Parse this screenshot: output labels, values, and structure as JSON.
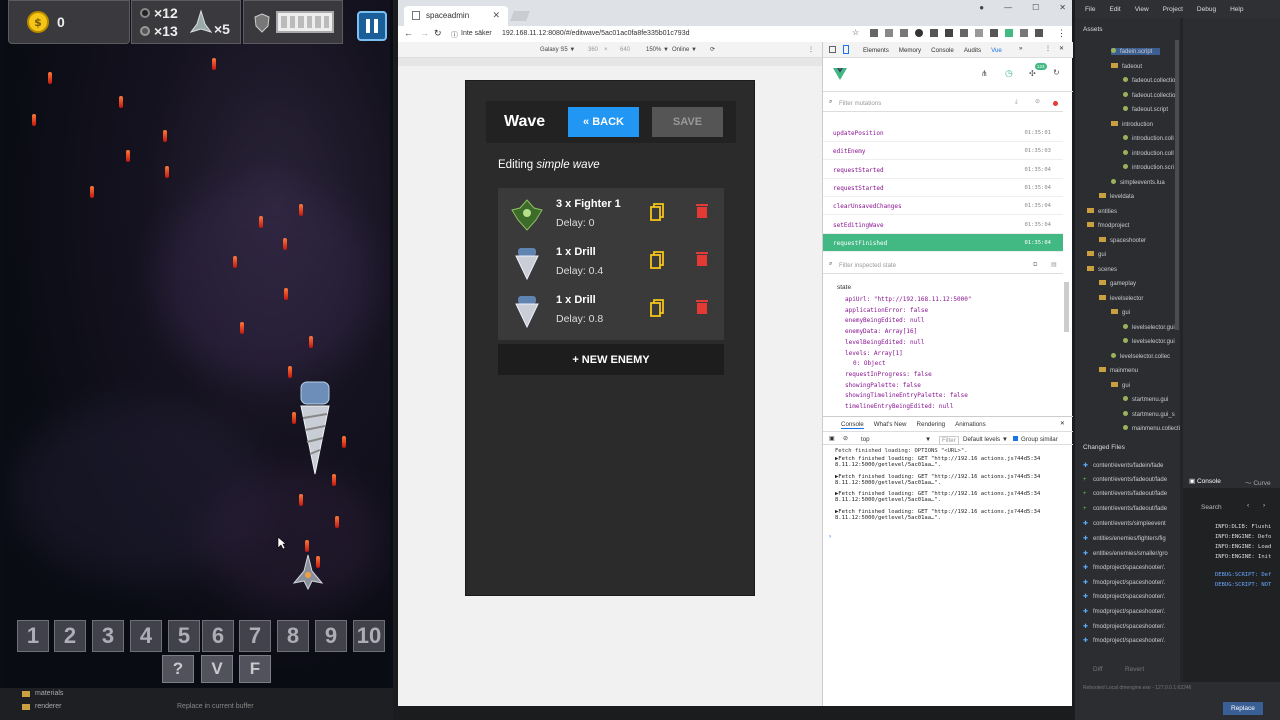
{
  "game": {
    "coins": "0",
    "mines": "×12",
    "bombs": "×13",
    "lives": "×5",
    "numkeys": [
      "1",
      "2",
      "3",
      "4",
      "5",
      "6",
      "7",
      "8",
      "9",
      "10"
    ],
    "letterkeys": [
      "?",
      "V",
      "F"
    ]
  },
  "editor_footer": {
    "items": [
      "materials",
      "renderer"
    ],
    "replace": "Replace in current buffer"
  },
  "browser": {
    "tab_title": "spaceadmin",
    "warn": "Inte säker",
    "url": "192.168.11.12:8080/#/editwave/5ac01ac0fa8fe335b01c793d",
    "device": "Galaxy S5 ▼",
    "w": "360",
    "h": "640",
    "zoom": "150% ▼",
    "net": "Online ▼"
  },
  "app": {
    "title": "Wave",
    "back": "« BACK",
    "save": "SAVE",
    "editing": "Editing",
    "wave_name": "simple wave",
    "new_enemy": "+ NEW ENEMY",
    "enemies": [
      {
        "name": "3 x Fighter 1",
        "delay": "Delay: 0"
      },
      {
        "name": "1 x Drill",
        "delay": "Delay: 0.4"
      },
      {
        "name": "1 x Drill",
        "delay": "Delay: 0.8"
      }
    ]
  },
  "devtools": {
    "tabs": [
      "Elements",
      "Memory",
      "Console",
      "Audits",
      "Vue"
    ],
    "filter_mutations": "Filter mutations",
    "filter_state": "Filter inspected state",
    "mutations": [
      {
        "n": "updatePosition",
        "t": "01:35:01"
      },
      {
        "n": "editEnemy",
        "t": "01:35:03"
      },
      {
        "n": "requestStarted",
        "t": "01:35:04"
      },
      {
        "n": "requestStarted",
        "t": "01:35:04"
      },
      {
        "n": "clearUnsavedChanges",
        "t": "01:35:04"
      },
      {
        "n": "setEditingWave",
        "t": "01:35:04"
      },
      {
        "n": "requestFinished",
        "t": "01:35:04"
      }
    ],
    "state_label": "state",
    "state": [
      "apiUrl: \"http://192.168.11.12:5000\"",
      "applicationError: false",
      "enemyBeingEdited: null",
      "enemyData: Array[16]",
      "levelBeingEdited: null",
      "levels: Array[1]",
      "0: Object",
      "requestInProgress: false",
      "showingPalette: false",
      "showingTimelineEntryPalette: false",
      "timelineEntryBeingEdited: null"
    ],
    "drawer_tabs": [
      "Console",
      "What's New",
      "Rendering",
      "Animations"
    ],
    "context": "top",
    "filter": "Filter",
    "levels": "Default levels ▼",
    "group": "Group similar",
    "console": [
      "Fetch finished loading: OPTIONS \"<URL>\".",
      "▶Fetch finished loading: GET \"http://192.16 actions.js?44d5:34 8.11.12:5000/getlevel/5ac01aa…\".",
      "▶Fetch finished loading: GET \"http://192.16 actions.js?44d5:34 8.11.12:5000/getlevel/5ac01aa…\".",
      "▶Fetch finished loading: GET \"http://192.16 actions.js?44d5:34 8.11.12:5000/getlevel/5ac01aa…\".",
      "▶Fetch finished loading: GET \"http://192.16 actions.js?44d5:34 8.11.12:5000/getlevel/5ac01aa…\"."
    ],
    "badge": "123"
  },
  "ide": {
    "menu": [
      "File",
      "Edit",
      "View",
      "Project",
      "Debug",
      "Help"
    ],
    "assets": "Assets",
    "tree": [
      "fadein.script",
      "fadeout",
      "fadeout.collectio",
      "fadeout.collectio",
      "fadeout.script",
      "introduction",
      "introduction.coll",
      "introduction.coll",
      "introduction.scri",
      "simpleevents.lua",
      "leveldata",
      "entities",
      "fmodproject",
      "spaceshooter",
      "gui",
      "scenes",
      "gameplay",
      "levelselector",
      "gui",
      "levelselector.gui",
      "levelselector.gui",
      "levelselector.collec",
      "mainmenu",
      "gui",
      "startmenu.gui",
      "startmenu.gui_s",
      "mainmenu.collecti"
    ],
    "changed_title": "Changed Files",
    "changed": [
      "content/events/fadein/fade",
      "content/events/fadeout/fade",
      "content/events/fadeout/fade",
      "content/events/fadeout/fade",
      "content/events/simpleevent",
      "entities/enemies/fighters/fig",
      "entities/enemies/smaller/gro",
      "fmodproject/spaceshooter/.",
      "fmodproject/spaceshooter/.",
      "fmodproject/spaceshooter/.",
      "fmodproject/spaceshooter/.",
      "fmodproject/spaceshooter/.",
      "fmodproject/spaceshooter/."
    ],
    "diff": "Diff",
    "revert": "Revert",
    "console_tab": "Console",
    "curve_tab": "Curve",
    "search": "Search",
    "log": [
      "INFO:DLIB: Flushi",
      "INFO:ENGINE: Defo",
      "INFO:ENGINE: Load",
      "INFO:ENGINE: Init",
      "DEBUG:SCRIPT: Def",
      "DEBUG:SCRIPT: NOT"
    ],
    "status": "Rebooted Local dmengine.exe - 127.0.0.1:62246",
    "replace": "Replace"
  }
}
